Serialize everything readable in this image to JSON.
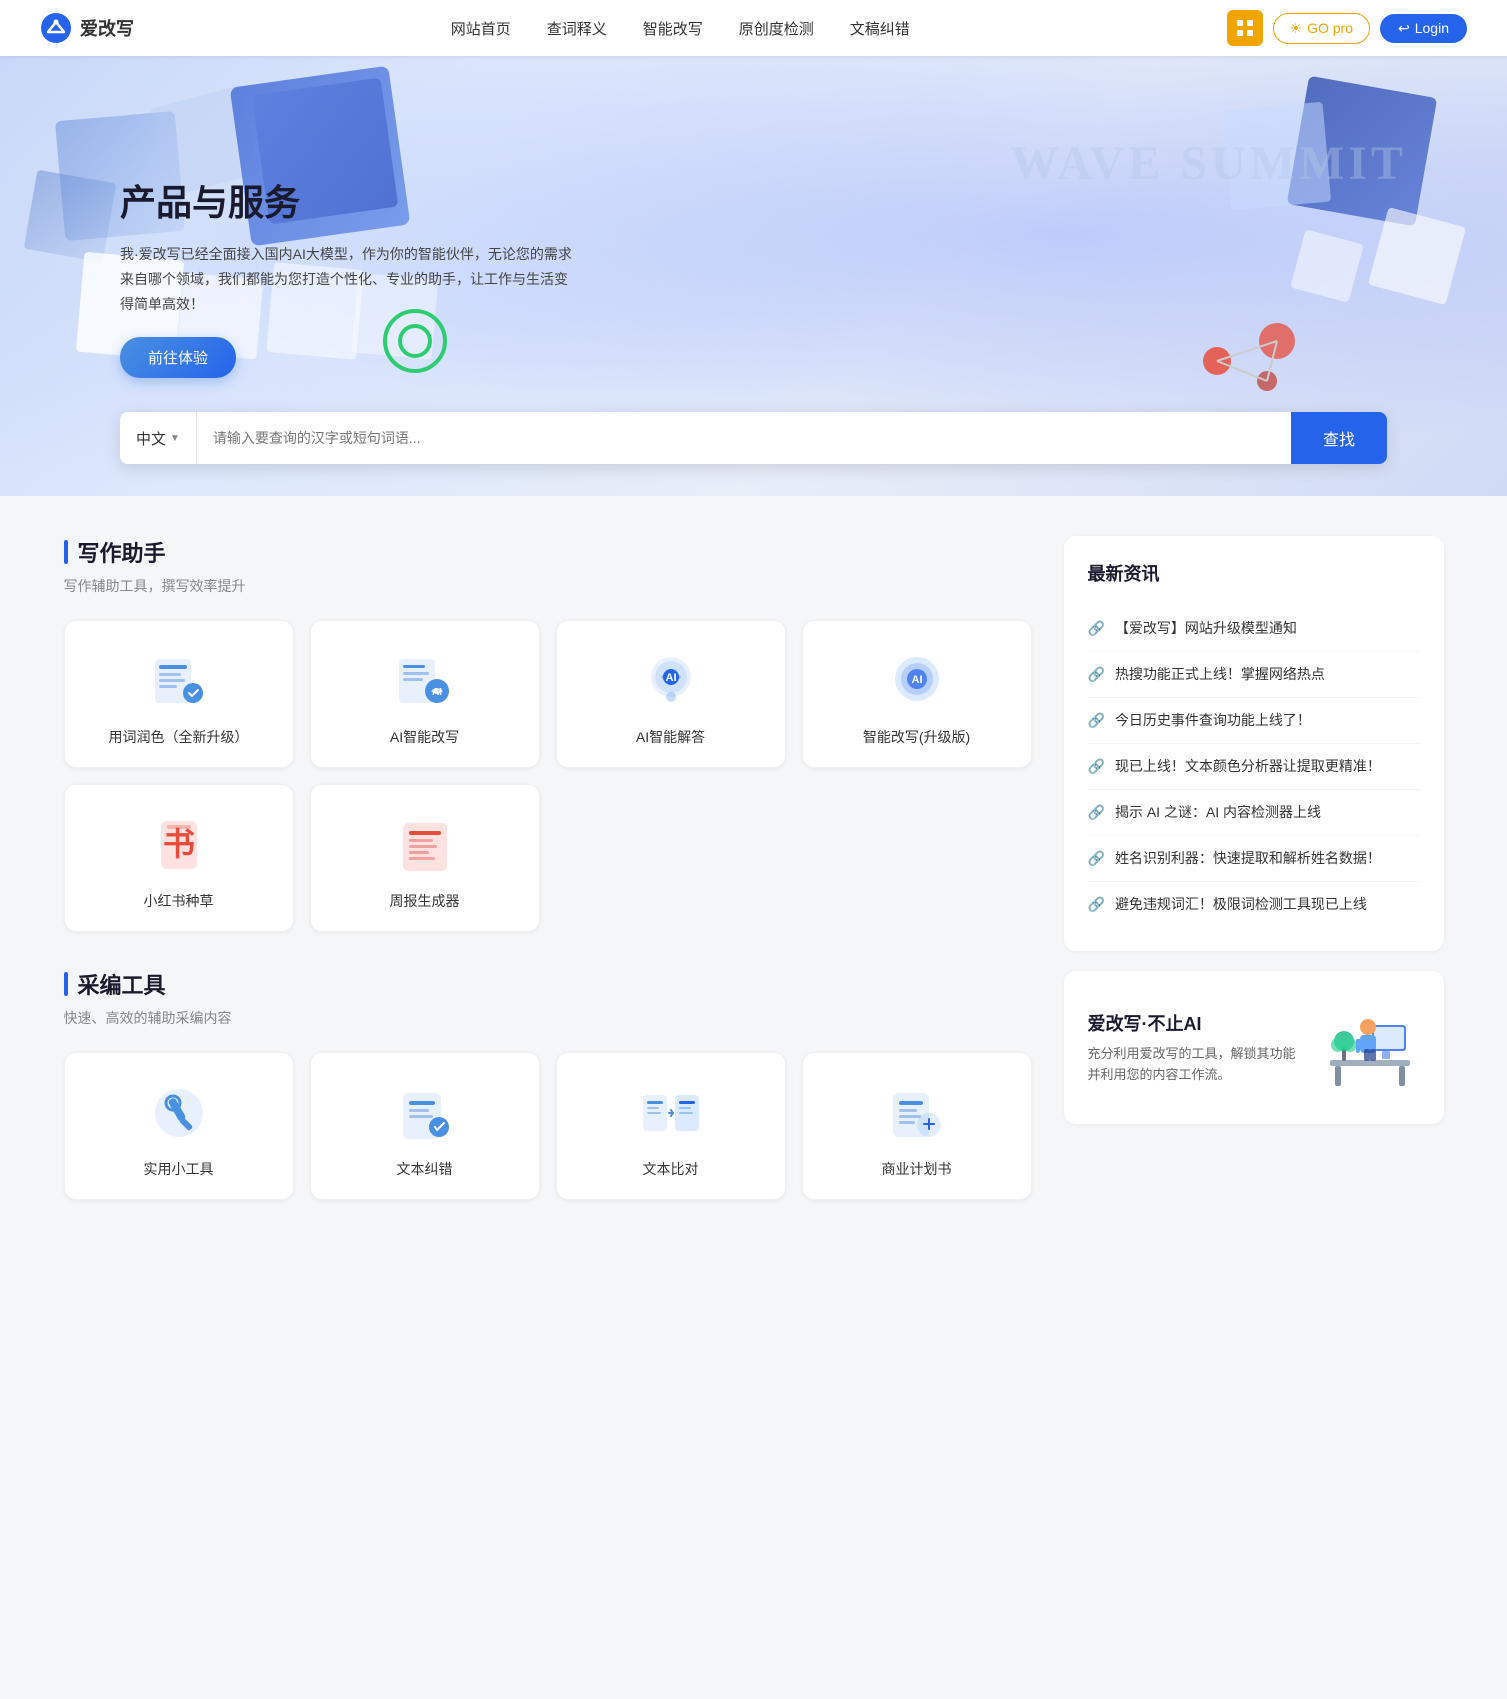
{
  "header": {
    "logo_text": "爱改写",
    "nav_items": [
      {
        "label": "网站首页",
        "id": "home"
      },
      {
        "label": "查词释义",
        "id": "dict"
      },
      {
        "label": "智能改写",
        "id": "rewrite"
      },
      {
        "label": "原创度检测",
        "id": "original"
      },
      {
        "label": "文稿纠错",
        "id": "correction"
      }
    ],
    "btn_grid_label": "Grid",
    "btn_go_pro_label": "GO pro",
    "btn_login_label": "Login"
  },
  "hero": {
    "title": "产品与服务",
    "desc": "我·爱改写已经全面接入国内AI大模型，作为你的智能伙伴，无论您的需求来自哪个领域，我们都能为您打造个性化、专业的助手，让工作与生活变得简单高效！",
    "cta_btn": "前往体验",
    "search_lang": "中文",
    "search_placeholder": "请输入要查询的汉字或短句词语...",
    "search_btn": "查找"
  },
  "writing_section": {
    "title": "写作助手",
    "subtitle": "写作辅助工具，撰写效率提升",
    "tools": [
      {
        "id": "word-polish",
        "label": "用词润色（全新升级）",
        "icon": "word-polish"
      },
      {
        "id": "ai-rewrite",
        "label": "AI智能改写",
        "icon": "ai-rewrite"
      },
      {
        "id": "ai-answer",
        "label": "AI智能解答",
        "icon": "ai-answer"
      },
      {
        "id": "smart-rewrite-pro",
        "label": "智能改写(升级版)",
        "icon": "smart-rewrite-pro"
      },
      {
        "id": "xiaohongshu",
        "label": "小红书种草",
        "icon": "xiaohongshu"
      },
      {
        "id": "weekly-report",
        "label": "周报生成器",
        "icon": "weekly-report"
      }
    ]
  },
  "caibian_section": {
    "title": "采编工具",
    "subtitle": "快速、高效的辅助采编内容",
    "tools": [
      {
        "id": "practical-tools",
        "label": "实用小工具",
        "icon": "practical"
      },
      {
        "id": "text-correction",
        "label": "文本纠错",
        "icon": "text-correction"
      },
      {
        "id": "text-compare",
        "label": "文本比对",
        "icon": "text-compare"
      },
      {
        "id": "business-plan",
        "label": "商业计划书",
        "icon": "business-plan"
      }
    ]
  },
  "news_section": {
    "title": "最新资讯",
    "items": [
      {
        "text": "【爱改写】网站升级模型通知"
      },
      {
        "text": "热搜功能正式上线！掌握网络热点"
      },
      {
        "text": "今日历史事件查询功能上线了！"
      },
      {
        "text": "现已上线！文本颜色分析器让提取更精准！"
      },
      {
        "text": "揭示 AI 之谜：AI 内容检测器上线"
      },
      {
        "text": "姓名识别利器：快速提取和解析姓名数据！"
      },
      {
        "text": "避免违规词汇！极限词检测工具现已上线"
      }
    ]
  },
  "promo": {
    "title": "爱改写·不止AI",
    "desc": "充分利用爱改写的工具，解锁其功能并利用您的内容工作流。"
  }
}
